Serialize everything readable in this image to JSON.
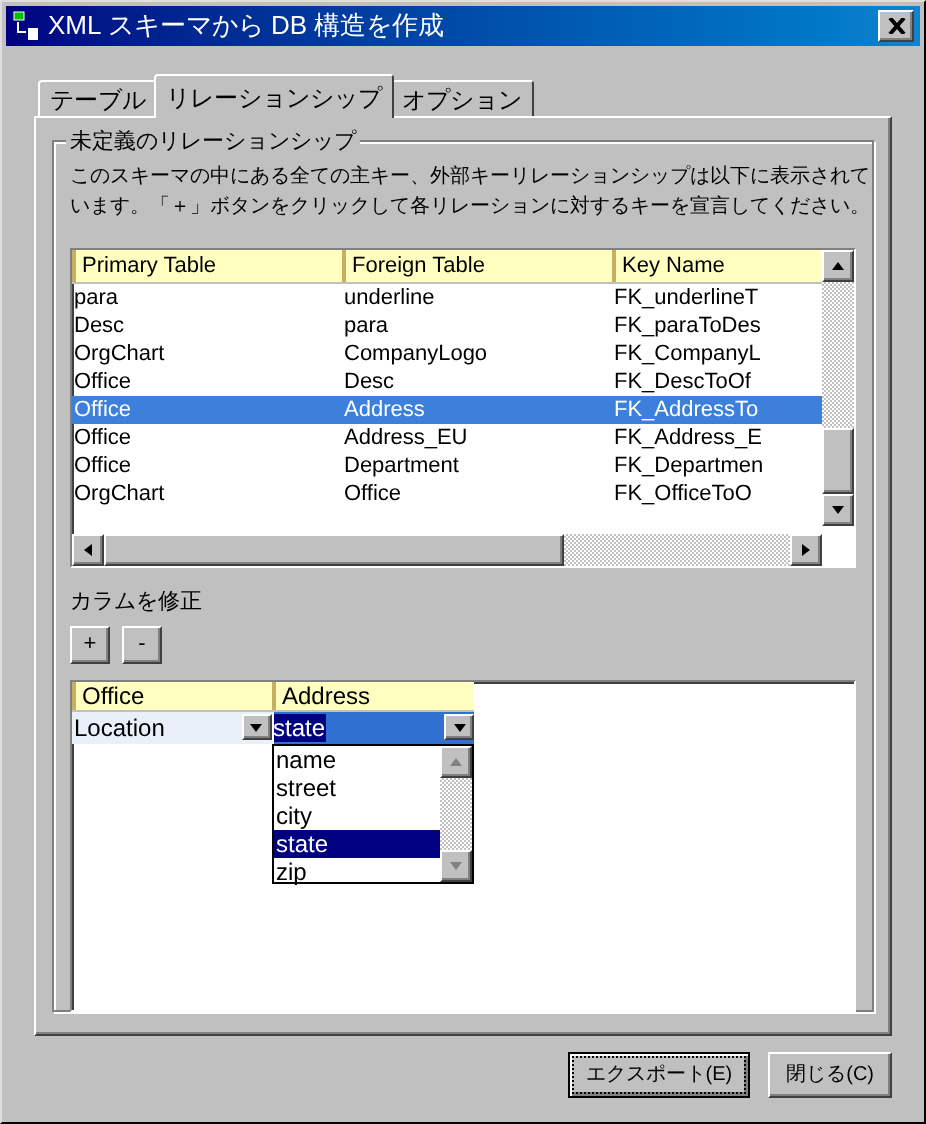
{
  "window": {
    "title": "XML スキーマから DB 構造を作成"
  },
  "tabs": [
    {
      "label": "テーブル",
      "selected": false
    },
    {
      "label": "リレーションシップ",
      "selected": true
    },
    {
      "label": "オプション",
      "selected": false
    }
  ],
  "group": {
    "title": "未定義のリレーションシップ",
    "description": "このスキーマの中にある全ての主キー、外部キーリレーションシップは以下に表示されています。「＋」ボタンをクリックして各リレーションに対するキーを宣言してください。"
  },
  "relationships": {
    "columns": [
      "Primary Table",
      "Foreign Table",
      "Key Name"
    ],
    "rows": [
      {
        "cells": [
          "para",
          "underline",
          "FK_underlineT"
        ],
        "selected": false
      },
      {
        "cells": [
          "Desc",
          "para",
          "FK_paraToDes"
        ],
        "selected": false
      },
      {
        "cells": [
          "OrgChart",
          "CompanyLogo",
          "FK_CompanyL"
        ],
        "selected": false
      },
      {
        "cells": [
          "Office",
          "Desc",
          "FK_DescToOf"
        ],
        "selected": false
      },
      {
        "cells": [
          "Office",
          "Address",
          "FK_AddressTo"
        ],
        "selected": true
      },
      {
        "cells": [
          "Office",
          "Address_EU",
          "FK_Address_E"
        ],
        "selected": false
      },
      {
        "cells": [
          "Office",
          "Department",
          "FK_Departmen"
        ],
        "selected": false
      },
      {
        "cells": [
          "OrgChart",
          "Office",
          "FK_OfficeToO"
        ],
        "selected": false
      }
    ]
  },
  "edit_columns": {
    "label": "カラムを修正",
    "buttons": [
      "+",
      "-"
    ]
  },
  "mapping": {
    "columns": [
      "Office",
      "Address"
    ],
    "rows": [
      {
        "source": "Location",
        "target": "state"
      }
    ],
    "dropdown": {
      "options": [
        {
          "label": "name",
          "selected": false
        },
        {
          "label": "street",
          "selected": false
        },
        {
          "label": "city",
          "selected": false
        },
        {
          "label": "state",
          "selected": true
        },
        {
          "label": "zip",
          "selected": false
        }
      ]
    }
  },
  "buttons": [
    {
      "label": "エクスポート(E)",
      "focused": true
    },
    {
      "label": "閉じる(C)",
      "focused": false
    }
  ]
}
